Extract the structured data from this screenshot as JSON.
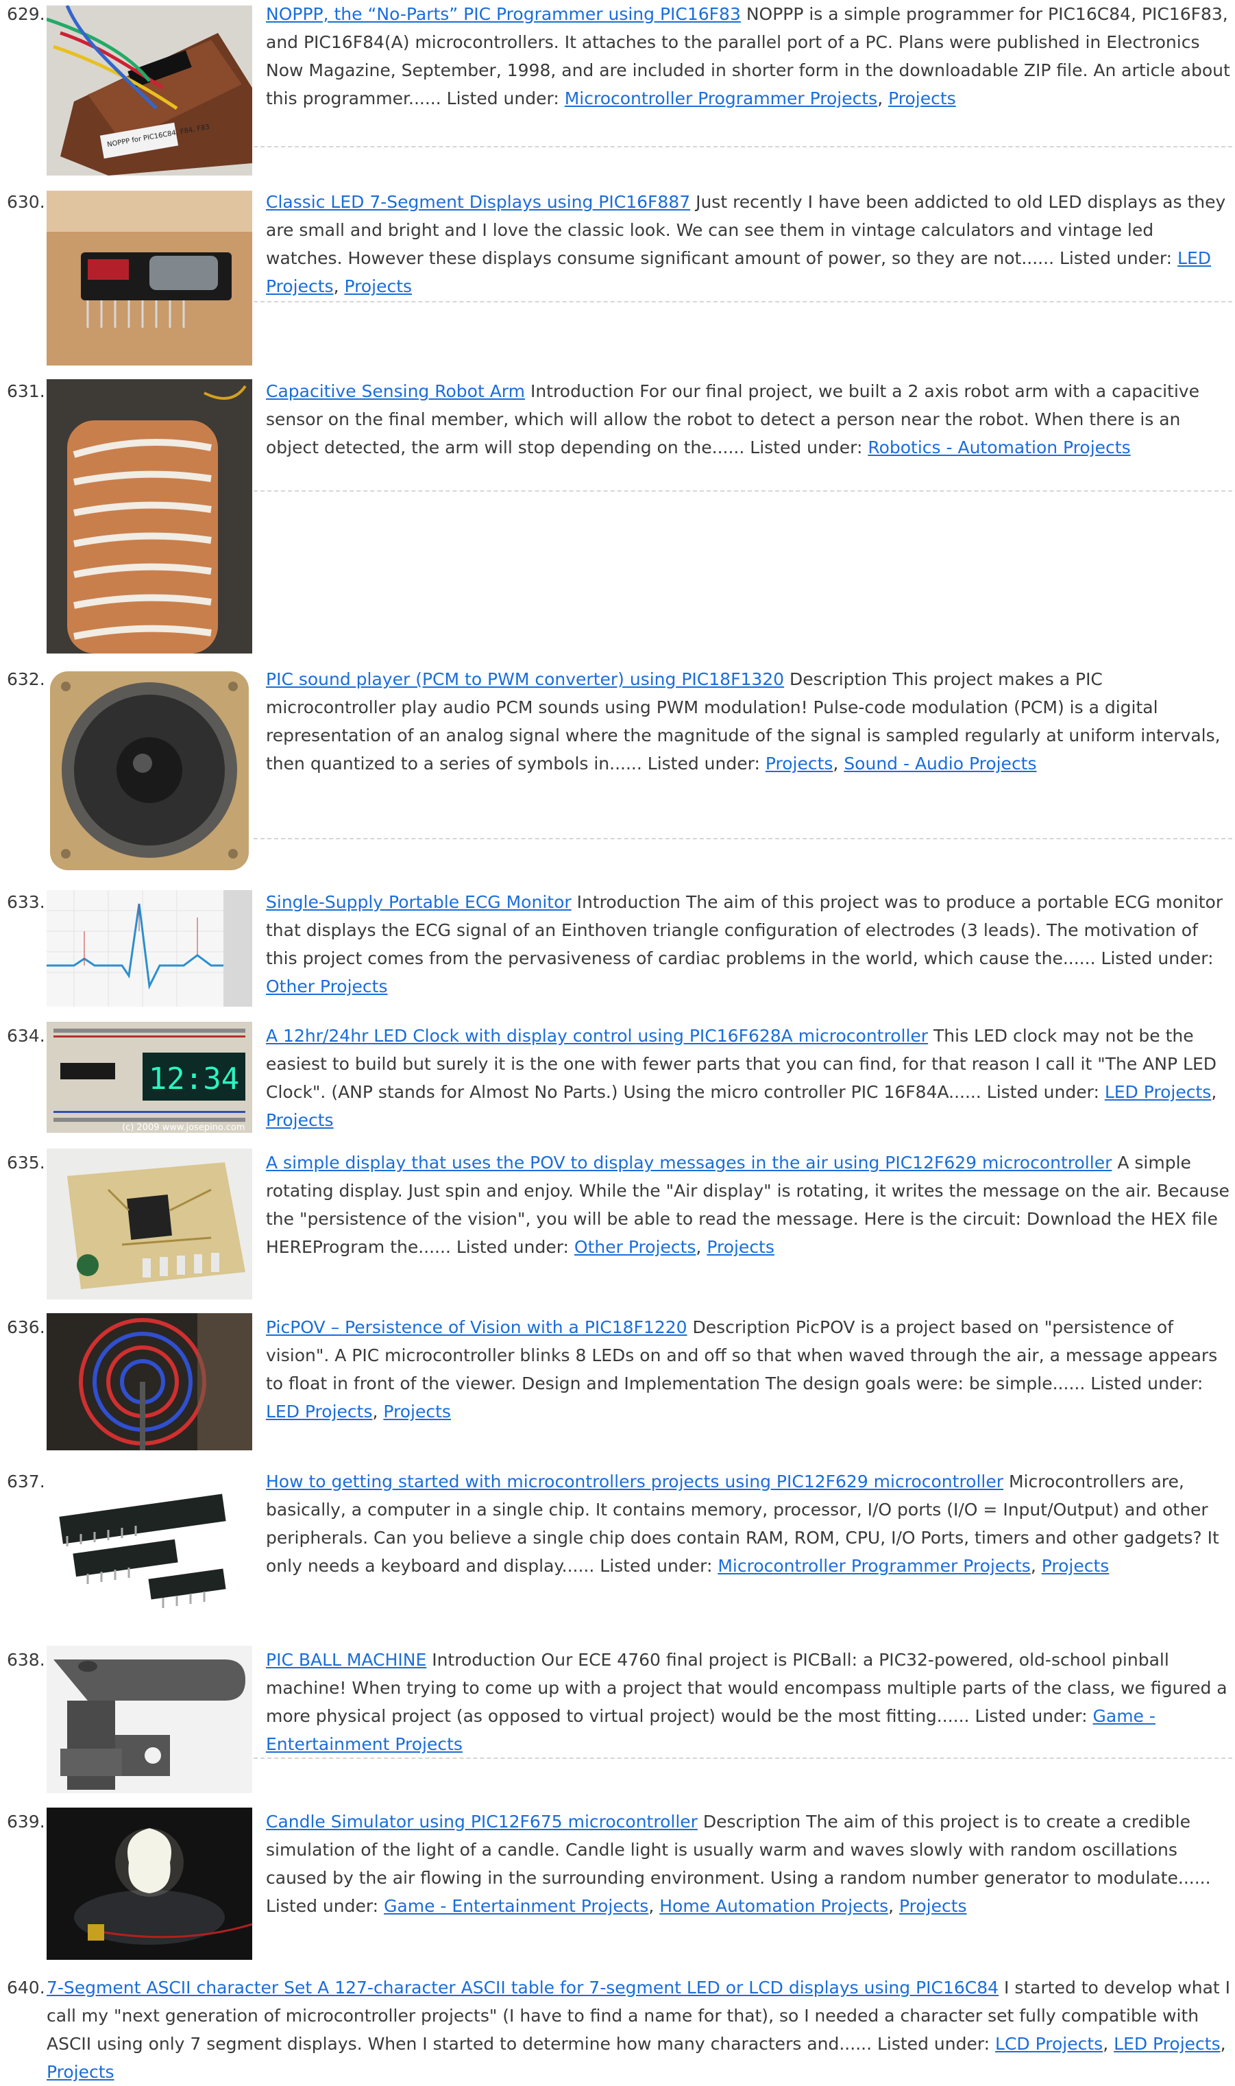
{
  "items": [
    {
      "num": "629.",
      "title": "NOPPP, the “No-Parts” PIC Programmer using PIC16F83",
      "desc": "NOPPP is a simple programmer for PIC16C84, PIC16F83, and PIC16F84(A) microcontrollers. It attaches to the parallel port of a PC. Plans were published in Electronics Now Magazine, September, 1998, and are included in shorter form in the downloadable ZIP file. An article about this programmer......",
      "listed_prefix": "Listed under:",
      "categories": [
        "Microcontroller Programmer Projects",
        "Projects"
      ],
      "thumb_label": "NOPPP for PIC16C84, F84, F83"
    },
    {
      "num": "630.",
      "title": "Classic LED 7-Segment Displays using PIC16F887",
      "desc": "Just recently I have been addicted to old LED displays as they are small and bright and I love the classic look. We can see them in vintage calculators and vintage led watches. However these displays consume significant amount of power, so they are not......",
      "listed_prefix": "Listed under:",
      "categories": [
        "LED Projects",
        "Projects"
      ]
    },
    {
      "num": "631.",
      "title": "Capacitive Sensing Robot Arm",
      "desc": "Introduction For our final project, we built a 2 axis robot arm with a capacitive sensor on the final member, which will allow the robot to detect a person near the robot. When there is an object detected, the arm will stop depending on the......",
      "listed_prefix": "Listed under:",
      "categories": [
        "Robotics - Automation Projects"
      ]
    },
    {
      "num": "632.",
      "title": "PIC sound player (PCM to PWM converter) using PIC18F1320",
      "desc": "Description This project makes a PIC microcontroller play audio PCM sounds using PWM modulation! Pulse-code modulation (PCM) is a digital representation of an analog signal where the magnitude of the signal is sampled regularly at uniform intervals, then quantized to a series of symbols in......",
      "listed_prefix": "Listed under:",
      "categories": [
        "Projects",
        "Sound - Audio Projects"
      ]
    },
    {
      "num": "633.",
      "title": "Single-Supply Portable ECG Monitor",
      "desc": "Introduction The aim of this project was to produce a portable ECG monitor that displays the ECG signal of an Einthoven triangle configuration of electrodes (3 leads). The motivation of this project comes from the pervasiveness of cardiac problems in the world, which cause the......",
      "listed_prefix": "Listed under:",
      "categories": [
        "Other Projects"
      ]
    },
    {
      "num": "634.",
      "title": "A 12hr/24hr LED Clock with display control using PIC16F628A microcontroller",
      "desc": "This LED clock may not be the easiest to build but surely it is the one with fewer parts that you can find, for that reason I call it \"The ANP LED Clock\". (ANP stands for Almost No Parts.) Using the micro controller PIC 16F84A......",
      "listed_prefix": "Listed under:",
      "categories": [
        "LED Projects",
        "Projects"
      ],
      "thumb_clock": "12:34",
      "thumb_caption": "(c) 2009 www.josepino.com"
    },
    {
      "num": "635.",
      "title": "A simple display that uses the POV to display messages in the air using PIC12F629 microcontroller",
      "desc": "A simple rotating display. Just spin and enjoy. While the \"Air display\" is rotating, it writes the message on the air. Because the \"persistence of the vision\", you will be able to read the message. Here is the circuit: Download the HEX file HEREProgram the......",
      "listed_prefix": "Listed under:",
      "categories": [
        "Other Projects",
        "Projects"
      ]
    },
    {
      "num": "636.",
      "title": "PicPOV – Persistence of Vision with a PIC18F1220",
      "desc": "Description PicPOV is a project based on \"persistence of vision\".  A PIC microcontroller blinks 8 LEDs on and off so that when waved through the air, a message appears to float in front of the viewer. Design and Implementation The design goals were: be simple......",
      "listed_prefix": "Listed under:",
      "categories": [
        "LED Projects",
        "Projects"
      ]
    },
    {
      "num": "637.",
      "title": "How to getting started with microcontrollers projects using PIC12F629 microcontroller",
      "desc": "Microcontrollers are, basically, a computer in a single chip. It contains memory, processor, I/O ports (I/O = Input/Output) and other peripherals. Can you believe a single chip does contain RAM, ROM, CPU, I/O Ports, timers and other gadgets? It only needs a keyboard and display......",
      "listed_prefix": "Listed under:",
      "categories": [
        "Microcontroller Programmer Projects",
        "Projects"
      ]
    },
    {
      "num": "638.",
      "title": "PIC BALL MACHINE",
      "desc": "Introduction Our ECE 4760 final project is PICBall: a PIC32-powered, old-school pinball machine! When trying to come up with a project that would encompass multiple parts of the class, we figured a more physical project (as opposed to virtual project) would be the most fitting......",
      "listed_prefix": "Listed under:",
      "categories": [
        "Game - Entertainment Projects"
      ]
    },
    {
      "num": "639.",
      "title": "Candle Simulator using PIC12F675 microcontroller",
      "desc": "Description The aim of this project is to create a credible simulation of the light of a candle. Candle light is usually warm and waves slowly with random oscillations caused by the air flowing in the surrounding environment. Using a random number generator to modulate......",
      "listed_prefix": "Listed under:",
      "categories": [
        "Game - Entertainment Projects",
        "Home Automation Projects",
        "Projects"
      ]
    },
    {
      "num": "640.",
      "title": "7-Segment ASCII character Set A 127-character ASCII table for 7-segment LED or LCD displays using PIC16C84",
      "desc": "I started to develop what I call my \"next generation of microcontroller projects\" (I have to find a name for that), so I needed a character set fully compatible with ASCII using only 7 segment displays. When I started to determine how many characters and......",
      "listed_prefix": "Listed under:",
      "categories": [
        "LCD Projects",
        "LED Projects",
        "Projects"
      ]
    }
  ]
}
